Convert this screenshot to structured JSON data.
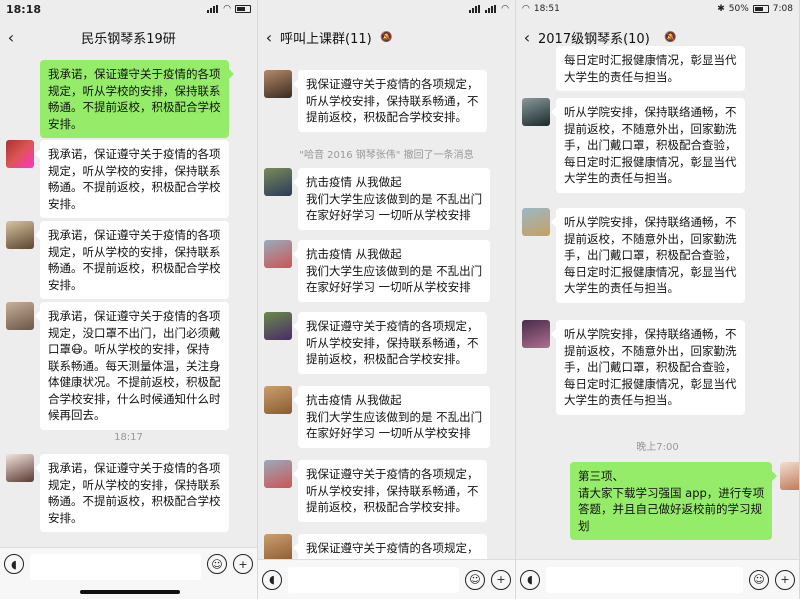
{
  "panel1": {
    "status_time": "18:18",
    "title": "民乐钢琴系19研",
    "messages": [
      {
        "lines": [
          "我承诺，保证遵守关于疫情的各项",
          "规定，听从学校的安排，保持联系",
          "畅通。不提前返校，积极配合学校",
          "安排。"
        ]
      },
      {
        "lines": [
          "我承诺，保证遵守关于疫情的各项",
          "规定，听从学校的安排，保持联系",
          "畅通。不提前返校，积极配合学校",
          "安排。"
        ]
      },
      {
        "lines": [
          "我承诺，保证遵守关于疫情的各项",
          "规定，听从学校的安排，保持联系",
          "畅通。不提前返校，积极配合学校",
          "安排。"
        ]
      },
      {
        "lines": [
          "我承诺，保证遵守关于疫情的各项",
          "规定，没口罩不出门，出门必须戴",
          "口罩😷。听从学校的安排，保持",
          "联系畅通。每天测量体温，关注身",
          "体健康状况。不提前返校，积极配",
          "合学校安排，什么时候通知什么时",
          "候再回去。"
        ]
      },
      {
        "lines": [
          "我承诺，保证遵守关于疫情的各项",
          "规定，听从学校的安排，保持联系",
          "畅通。不提前返校，积极配合学校",
          "安排。"
        ]
      }
    ],
    "time_divider": "18:17"
  },
  "panel2": {
    "title": "呼叫上课群(11)",
    "messages": [
      {
        "lines": [
          "我保证遵守关于疫情的各项规定，",
          "听从学校安排，保持联系畅通，不",
          "提前返校，积极配合学校安排。"
        ]
      },
      {
        "lines": [
          "抗击疫情 从我做起",
          "我们大学生应该做到的是 不乱出门",
          "在家好好学习 一切听从学校安排"
        ]
      },
      {
        "lines": [
          "抗击疫情 从我做起",
          "我们大学生应该做到的是 不乱出门",
          "在家好好学习 一切听从学校安排"
        ]
      },
      {
        "lines": [
          "我保证遵守关于疫情的各项规定，",
          "听从学校安排，保持联系畅通，不",
          "提前返校，积极配合学校安排。"
        ]
      },
      {
        "lines": [
          "抗击疫情 从我做起",
          "我们大学生应该做到的是 不乱出门",
          "在家好好学习 一切听从学校安排"
        ]
      },
      {
        "lines": [
          "我保证遵守关于疫情的各项规定，",
          "听从学校安排，保持联系畅通，不",
          "提前返校，积极配合学校安排。"
        ]
      },
      {
        "lines": [
          "我保证遵守关于疫情的各项规定，"
        ]
      }
    ],
    "recall_notice": "\"哈音 2016 钢琴张伟\" 撤回了一条消息"
  },
  "panel3": {
    "status_time": "18:51",
    "status_right_time": "7:08",
    "battery": "50%",
    "title": "2017级钢琴系(10)",
    "messages": [
      {
        "lines": [
          "每日定时汇报健康情况，彰显当代",
          "大学生的责任与担当。"
        ]
      },
      {
        "lines": [
          "听从学院安排，保持联络通畅，不",
          "提前返校，不随意外出，回家勤洗",
          "手，出门戴口罩，积极配合查验，",
          "每日定时汇报健康情况，彰显当代",
          "大学生的责任与担当。"
        ]
      },
      {
        "lines": [
          "听从学院安排，保持联络通畅，不",
          "提前返校，不随意外出，回家勤洗",
          "手，出门戴口罩，积极配合查验，",
          "每日定时汇报健康情况，彰显当代",
          "大学生的责任与担当。"
        ]
      },
      {
        "lines": [
          "听从学院安排，保持联络通畅，不",
          "提前返校，不随意外出，回家勤洗",
          "手，出门戴口罩，积极配合查验，",
          "每日定时汇报健康情况，彰显当代",
          "大学生的责任与担当。"
        ]
      },
      {
        "lines": [
          "第三项、",
          "请大家下载学习强国 app，进行专项",
          "答题，并且自己做好返校前的学习规",
          "划"
        ]
      }
    ],
    "time_divider": "晚上7:00"
  },
  "colors": {
    "bg": "#ededed",
    "bubble": "#ffffff",
    "self_bubble": "#95ec69"
  },
  "icons": [
    "back-chevron-icon",
    "mute-bell-icon",
    "voice-icon",
    "emoji-icon",
    "plus-icon"
  ]
}
